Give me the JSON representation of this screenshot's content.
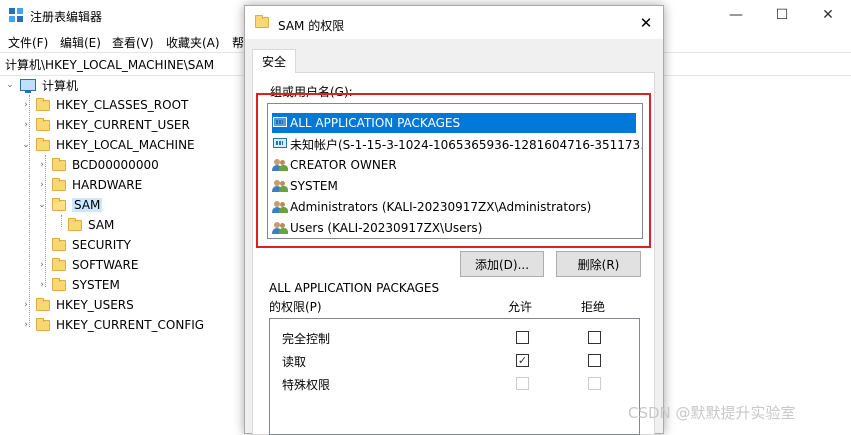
{
  "regedit": {
    "title": "注册表编辑器",
    "window_controls": {
      "minimize": "—",
      "maximize": "☐",
      "close": "✕"
    },
    "menu": [
      "文件(F)",
      "编辑(E)",
      "查看(V)",
      "收藏夹(A)",
      "帮"
    ],
    "address": "计算机\\HKEY_LOCAL_MACHINE\\SAM",
    "tree": {
      "root": "计算机",
      "items": [
        {
          "label": "HKEY_CLASSES_ROOT",
          "expander": "›"
        },
        {
          "label": "HKEY_CURRENT_USER",
          "expander": "›"
        },
        {
          "label": "HKEY_LOCAL_MACHINE",
          "expander": "⌄"
        },
        {
          "label": "BCD00000000",
          "expander": "›"
        },
        {
          "label": "HARDWARE",
          "expander": "›"
        },
        {
          "label": "SAM",
          "expander": "⌄"
        },
        {
          "label": "SAM",
          "expander": ""
        },
        {
          "label": "SECURITY",
          "expander": ""
        },
        {
          "label": "SOFTWARE",
          "expander": "›"
        },
        {
          "label": "SYSTEM",
          "expander": "›"
        },
        {
          "label": "HKEY_USERS",
          "expander": "›"
        },
        {
          "label": "HKEY_CURRENT_CONFIG",
          "expander": "›"
        }
      ]
    }
  },
  "dialog": {
    "title": "SAM 的权限",
    "close": "✕",
    "tab": "安全",
    "group_label": "组或用户名(G):",
    "users": [
      {
        "name": "ALL APPLICATION PACKAGES",
        "icon": "app-packages-icon"
      },
      {
        "name": "未知帐户(S-1-15-3-1024-1065365936-1281604716-351173…",
        "icon": "unknown-account-icon"
      },
      {
        "name": "CREATOR OWNER",
        "icon": "user-group-icon"
      },
      {
        "name": "SYSTEM",
        "icon": "user-group-icon"
      },
      {
        "name": "Administrators (KALI-20230917ZX\\Administrators)",
        "icon": "user-group-icon"
      },
      {
        "name": "Users (KALI-20230917ZX\\Users)",
        "icon": "user-group-icon"
      }
    ],
    "add_button": "添加(D)...",
    "remove_button": "删除(R)",
    "perm_title": "ALL APPLICATION PACKAGES",
    "perm_label": "的权限(P)",
    "col_allow": "允许",
    "col_deny": "拒绝",
    "permissions": [
      {
        "name": "完全控制",
        "allow": false,
        "deny": false,
        "disabled": false
      },
      {
        "name": "读取",
        "allow": true,
        "deny": false,
        "disabled": false
      },
      {
        "name": "特殊权限",
        "allow": false,
        "deny": false,
        "disabled": true
      }
    ],
    "check_mark": "✓"
  },
  "watermark": "CSDN @默默提升实验室",
  "colors": {
    "selection": "#0078d7",
    "highlight_border": "#e02020",
    "folder": "#f8d775"
  }
}
